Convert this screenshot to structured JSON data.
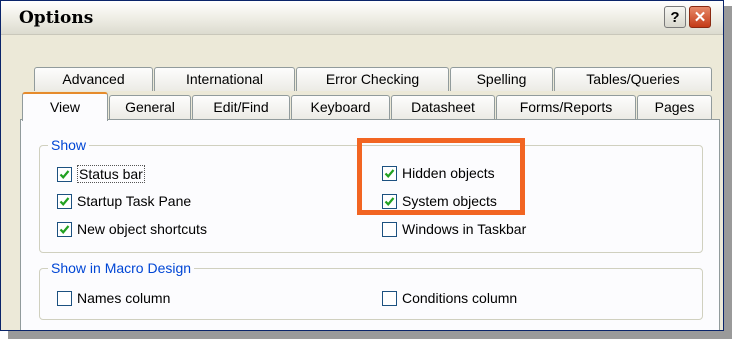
{
  "window": {
    "title": "Options"
  },
  "titlebar": {
    "help_icon": "?",
    "close_icon": "✕"
  },
  "tabs_back": [
    "Advanced",
    "International",
    "Error Checking",
    "Spelling",
    "Tables/Queries"
  ],
  "tabs_front": [
    "View",
    "General",
    "Edit/Find",
    "Keyboard",
    "Datasheet",
    "Forms/Reports",
    "Pages"
  ],
  "active_tab": "View",
  "show_group": {
    "legend": "Show",
    "items": [
      {
        "label": "Status bar",
        "checked": true
      },
      {
        "label": "Startup Task Pane",
        "checked": true
      },
      {
        "label": "New object shortcuts",
        "checked": true
      },
      {
        "label": "Hidden objects",
        "checked": true
      },
      {
        "label": "System objects",
        "checked": true
      },
      {
        "label": "Windows in Taskbar",
        "checked": false
      }
    ]
  },
  "macro_group": {
    "legend": "Show in Macro Design",
    "items": [
      {
        "label": "Names column",
        "checked": false
      },
      {
        "label": "Conditions column",
        "checked": false
      }
    ]
  },
  "colors": {
    "highlight": "#f26522",
    "legend_text": "#0046d5",
    "checkmark": "#21a121"
  }
}
